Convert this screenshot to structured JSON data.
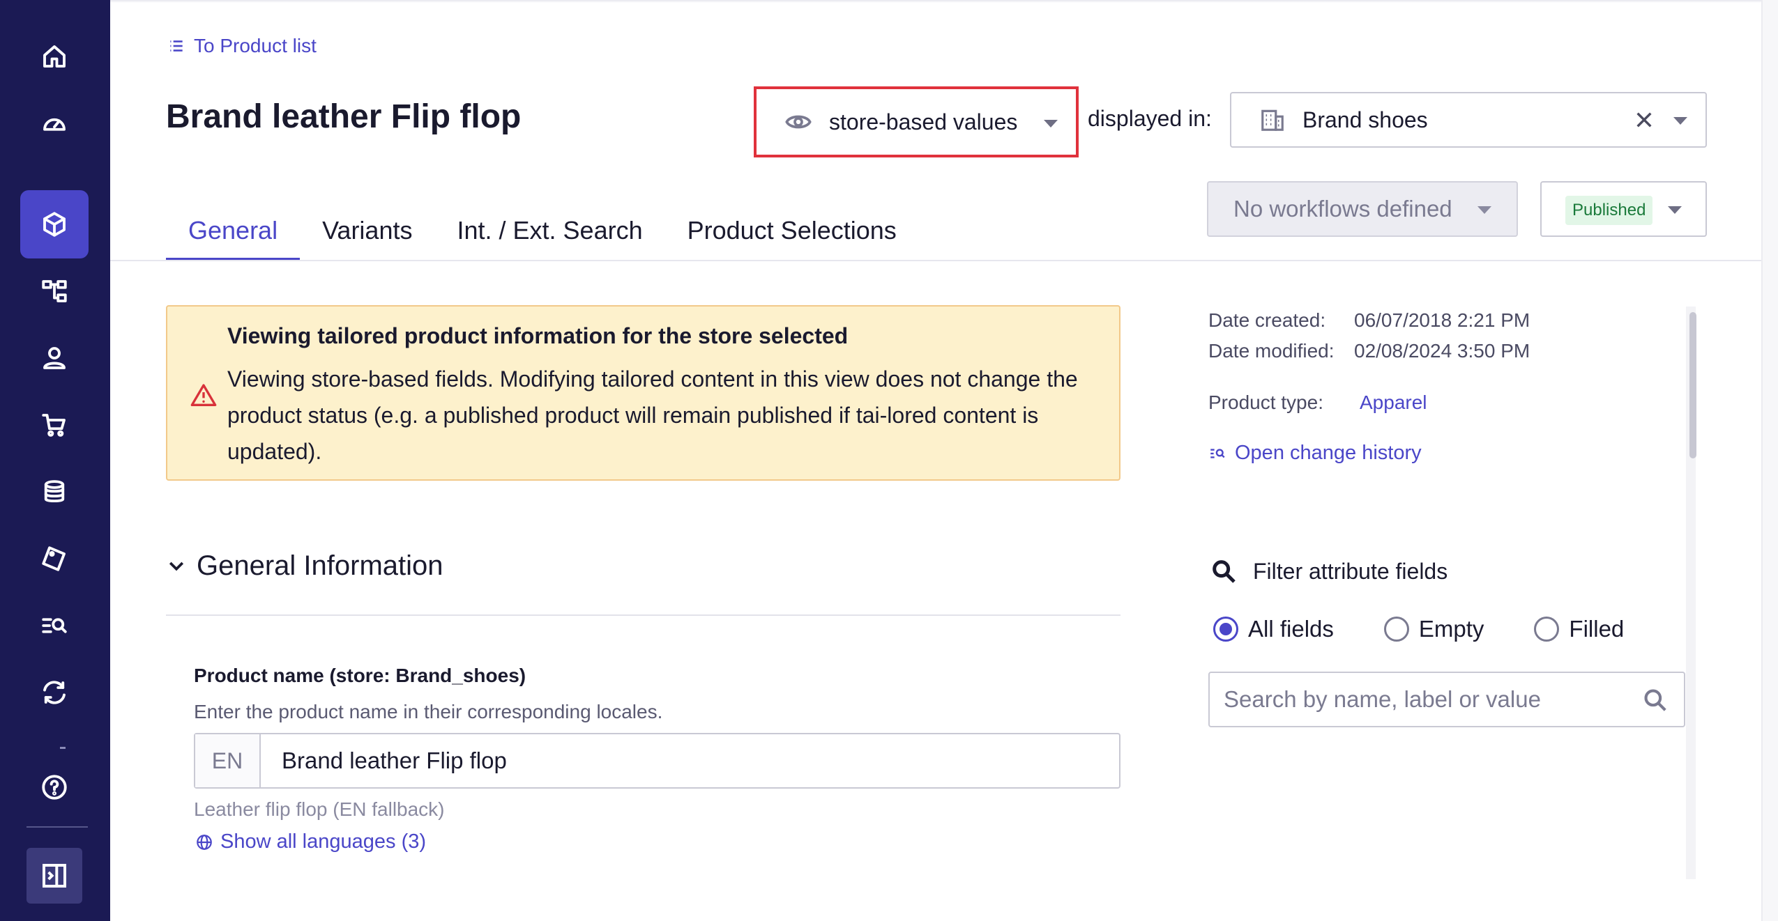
{
  "nav": {
    "items": [
      {
        "icon": "home-icon"
      },
      {
        "icon": "dashboard-icon"
      },
      {
        "icon": "product-cube-icon",
        "active": true
      },
      {
        "icon": "category-tree-icon"
      },
      {
        "icon": "user-icon"
      },
      {
        "icon": "cart-icon"
      },
      {
        "icon": "data-stack-icon"
      },
      {
        "icon": "tag-icon"
      },
      {
        "icon": "search-list-icon"
      },
      {
        "icon": "sync-icon"
      },
      {
        "icon": "help-icon"
      }
    ],
    "collapse_icon": "sidebar-collapse-icon"
  },
  "header": {
    "back_link": "To Product list",
    "title": "Brand leather Flip flop",
    "view_mode": "store-based values",
    "displayed_in_label": "displayed in:",
    "store": "Brand shoes",
    "workflow": "No workflows defined",
    "status": "Published"
  },
  "tabs": [
    {
      "label": "General",
      "active": true
    },
    {
      "label": "Variants"
    },
    {
      "label": "Int. / Ext. Search"
    },
    {
      "label": "Product Selections"
    }
  ],
  "alert": {
    "title": "Viewing tailored product information for the store selected",
    "body": "Viewing store-based fields. Modifying tailored content in this view does not change the product status (e.g. a published product will remain published if tai-lored content is updated)."
  },
  "general": {
    "section_title": "General Information",
    "field_label": "Product name (store: Brand_shoes)",
    "field_help": "Enter the product name in their corresponding locales.",
    "locale": "EN",
    "value": "Brand leather Flip flop",
    "fallback": "Leather flip flop (EN fallback)",
    "show_languages": "Show all languages (3)"
  },
  "meta": {
    "created_label": "Date created:",
    "created_value": "06/07/2018 2:21 PM",
    "modified_label": "Date modified:",
    "modified_value": "02/08/2024 3:50 PM",
    "type_label": "Product type:",
    "type_value": "Apparel",
    "history_link": "Open change history"
  },
  "filter": {
    "title": "Filter attribute fields",
    "options": [
      "All fields",
      "Empty",
      "Filled"
    ],
    "selected": "All fields",
    "search_placeholder": "Search by name, label or value"
  },
  "colors": {
    "sidebar": "#1b1a54",
    "accent": "#4a46c8",
    "highlight_border": "#e0323c",
    "alert_bg": "#fdf1cc"
  }
}
